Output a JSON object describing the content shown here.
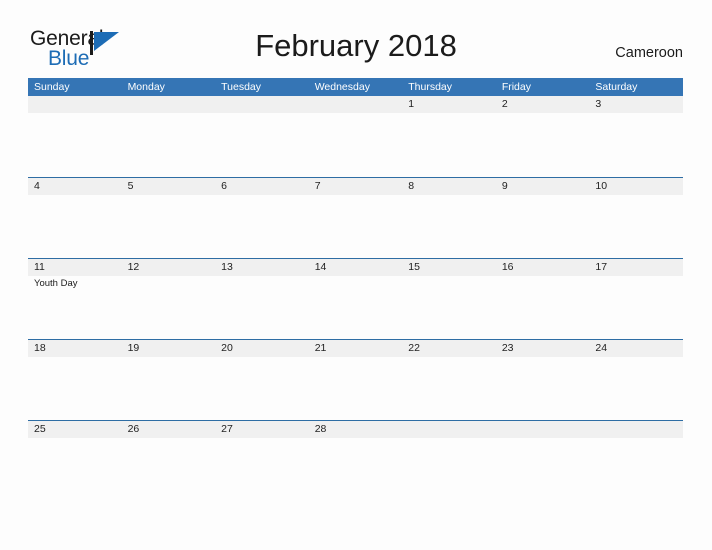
{
  "brand": {
    "name_part1": "General",
    "name_part2": "Blue",
    "flag_icon": "blue-triangle-flag-icon",
    "accent_color": "#1d6cb5"
  },
  "header": {
    "title": "February 2018",
    "locale": "Cameroon"
  },
  "colors": {
    "header_blue": "#3575b5",
    "separator_blue": "#2e6da4",
    "date_band_gray": "#f0f0f0",
    "page_background": "#fdfdfd",
    "text_dark": "#1b1b1b"
  },
  "calendar": {
    "month": "February",
    "year": "2018",
    "weekday_headers": [
      "Sunday",
      "Monday",
      "Tuesday",
      "Wednesday",
      "Thursday",
      "Friday",
      "Saturday"
    ],
    "weeks": [
      {
        "days": [
          {
            "date": "",
            "events": []
          },
          {
            "date": "",
            "events": []
          },
          {
            "date": "",
            "events": []
          },
          {
            "date": "",
            "events": []
          },
          {
            "date": "1",
            "events": []
          },
          {
            "date": "2",
            "events": []
          },
          {
            "date": "3",
            "events": []
          }
        ]
      },
      {
        "days": [
          {
            "date": "4",
            "events": []
          },
          {
            "date": "5",
            "events": []
          },
          {
            "date": "6",
            "events": []
          },
          {
            "date": "7",
            "events": []
          },
          {
            "date": "8",
            "events": []
          },
          {
            "date": "9",
            "events": []
          },
          {
            "date": "10",
            "events": []
          }
        ]
      },
      {
        "days": [
          {
            "date": "11",
            "events": [
              "Youth Day"
            ]
          },
          {
            "date": "12",
            "events": []
          },
          {
            "date": "13",
            "events": []
          },
          {
            "date": "14",
            "events": []
          },
          {
            "date": "15",
            "events": []
          },
          {
            "date": "16",
            "events": []
          },
          {
            "date": "17",
            "events": []
          }
        ]
      },
      {
        "days": [
          {
            "date": "18",
            "events": []
          },
          {
            "date": "19",
            "events": []
          },
          {
            "date": "20",
            "events": []
          },
          {
            "date": "21",
            "events": []
          },
          {
            "date": "22",
            "events": []
          },
          {
            "date": "23",
            "events": []
          },
          {
            "date": "24",
            "events": []
          }
        ]
      },
      {
        "days": [
          {
            "date": "25",
            "events": []
          },
          {
            "date": "26",
            "events": []
          },
          {
            "date": "27",
            "events": []
          },
          {
            "date": "28",
            "events": []
          },
          {
            "date": "",
            "events": []
          },
          {
            "date": "",
            "events": []
          },
          {
            "date": "",
            "events": []
          }
        ]
      }
    ]
  }
}
